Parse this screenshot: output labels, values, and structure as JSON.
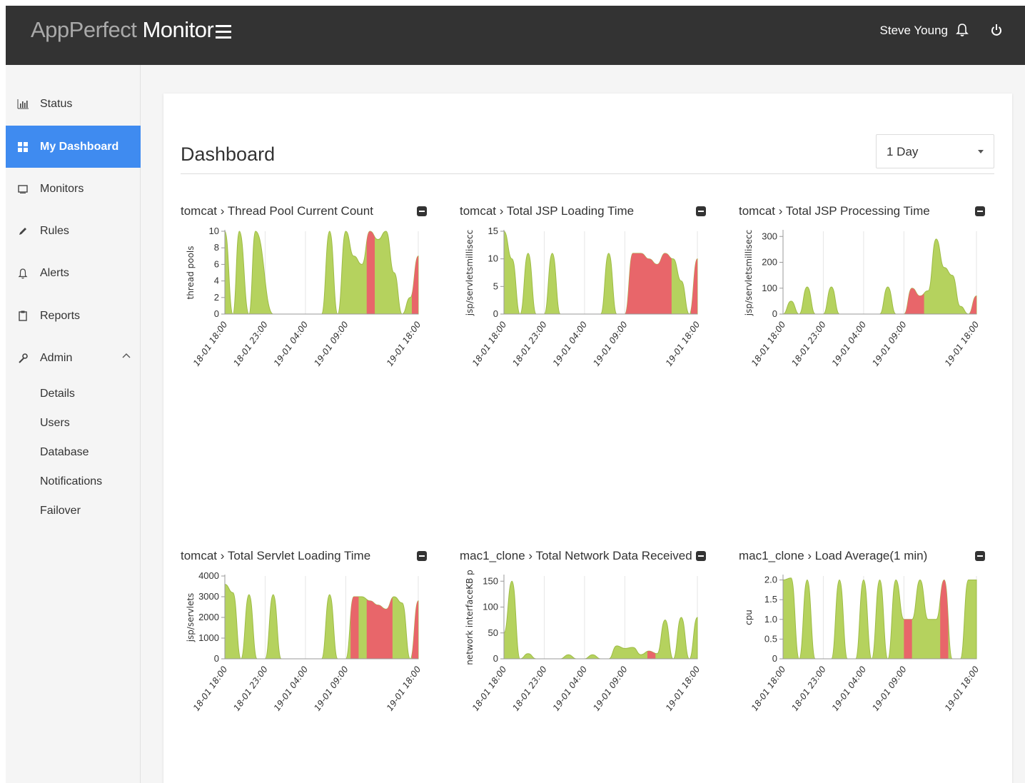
{
  "app": {
    "brand_light": "AppPerfect",
    "brand_strong": " Monitor",
    "user": "Steve Young"
  },
  "sidebar": {
    "items": [
      {
        "label": "Status",
        "icon": "bar-chart-icon"
      },
      {
        "label": "My Dashboard",
        "icon": "grid-icon",
        "active": true
      },
      {
        "label": "Monitors",
        "icon": "monitor-icon"
      },
      {
        "label": "Rules",
        "icon": "pencil-icon"
      },
      {
        "label": "Alerts",
        "icon": "bell-icon"
      },
      {
        "label": "Reports",
        "icon": "clipboard-icon"
      },
      {
        "label": "Admin",
        "icon": "wrench-icon",
        "expanded": true
      }
    ],
    "admin_sub": [
      "Details",
      "Users",
      "Database",
      "Notifications",
      "Failover"
    ]
  },
  "dashboard": {
    "title": "Dashboard",
    "range": "1 Day"
  },
  "colors": {
    "green": "#b5d25e",
    "green_stroke": "#9dbb45",
    "red": "#e8666a",
    "grid": "#e6e6e6"
  },
  "chart_data": [
    {
      "type": "area",
      "title": "tomcat › Thread Pool Current Count",
      "ylabel": "thread pools",
      "yticks": [
        0,
        2,
        4,
        6,
        8,
        10
      ],
      "ylim": [
        0,
        10
      ],
      "xticks": [
        "18-01 18:00",
        "18-01 23:00",
        "19-01 04:00",
        "19-01 09:00",
        "19-01 18:00"
      ],
      "xtick_pos": [
        0,
        5,
        10,
        15,
        24
      ],
      "x": [
        0,
        1,
        1.8,
        3,
        3.8,
        6,
        7,
        8,
        12,
        13,
        14,
        15,
        16,
        17,
        18,
        19,
        20,
        21,
        22,
        23,
        24
      ],
      "y": [
        10,
        0,
        10,
        0,
        10,
        0,
        0,
        0,
        0,
        10,
        0,
        10,
        7,
        6,
        10,
        9,
        10,
        5,
        0,
        2,
        7
      ],
      "red": [
        [
          17.6,
          18.6
        ],
        [
          23.2,
          24
        ]
      ]
    },
    {
      "type": "area",
      "title": "tomcat › Total JSP Loading Time",
      "ylabel": "jsp/servletsmillisecc",
      "yticks": [
        0,
        5,
        10,
        15
      ],
      "ylim": [
        0,
        15
      ],
      "xticks": [
        "18-01 18:00",
        "18-01 23:00",
        "19-01 04:00",
        "19-01 09:00",
        "19-01 18:00"
      ],
      "xtick_pos": [
        0,
        5,
        10,
        15,
        24
      ],
      "x": [
        0,
        1,
        2,
        3,
        4,
        5,
        6,
        7,
        8,
        12,
        13,
        14,
        15,
        16,
        17,
        18,
        19,
        20,
        21,
        22,
        23,
        24
      ],
      "y": [
        15,
        10,
        0,
        11,
        0,
        0,
        11,
        0,
        0,
        0,
        11,
        0,
        0,
        11,
        11,
        10,
        9,
        11,
        10,
        6,
        0,
        10
      ],
      "red": [
        [
          15,
          20.8
        ],
        [
          23.2,
          24
        ]
      ]
    },
    {
      "type": "area",
      "title": "tomcat › Total JSP Processing Time",
      "ylabel": "jsp/servletsmillisecc",
      "yticks": [
        0,
        100,
        200,
        300
      ],
      "ylim": [
        0,
        320
      ],
      "xticks": [
        "18-01 18:00",
        "18-01 23:00",
        "19-01 04:00",
        "19-01 09:00",
        "19-01 18:00"
      ],
      "xtick_pos": [
        0,
        5,
        10,
        15,
        24
      ],
      "x": [
        0,
        1,
        2,
        3,
        4,
        5,
        6,
        7,
        8,
        12,
        13,
        14,
        15,
        16,
        17,
        18,
        19,
        20,
        21,
        22,
        23,
        24
      ],
      "y": [
        0,
        50,
        0,
        105,
        0,
        0,
        105,
        0,
        0,
        0,
        105,
        0,
        0,
        100,
        70,
        90,
        290,
        180,
        150,
        30,
        0,
        70
      ],
      "red": [
        [
          14.5,
          17.5
        ],
        [
          23.2,
          24
        ]
      ]
    },
    {
      "type": "area",
      "title": "tomcat › Total Servlet Loading Time",
      "ylabel": "jsp/servlets",
      "yticks": [
        0,
        1000,
        2000,
        3000,
        4000
      ],
      "ylim": [
        0,
        4000
      ],
      "xticks": [
        "18-01 18:00",
        "18-01 23:00",
        "19-01 04:00",
        "19-01 09:00",
        "19-01 18:00"
      ],
      "xtick_pos": [
        0,
        5,
        10,
        15,
        24
      ],
      "x": [
        0,
        1,
        2,
        3,
        4,
        5,
        6,
        7,
        8,
        12,
        13,
        14,
        15,
        16,
        17,
        18,
        19,
        20,
        21,
        22,
        23,
        24
      ],
      "y": [
        3600,
        3200,
        0,
        3100,
        0,
        0,
        3100,
        0,
        0,
        0,
        3100,
        0,
        0,
        3000,
        3000,
        2800,
        2600,
        2400,
        3000,
        2700,
        0,
        2800
      ],
      "red": [
        [
          15.6,
          16.6
        ],
        [
          17.6,
          20.8
        ],
        [
          23.2,
          24
        ]
      ]
    },
    {
      "type": "area",
      "title": "mac1_clone › Total Network Data Received",
      "ylabel": "network interfaceKB p",
      "yticks": [
        0,
        50,
        100,
        150
      ],
      "ylim": [
        0,
        160
      ],
      "xticks": [
        "18-01 18:00",
        "18-01 23:00",
        "19-01 04:00",
        "19-01 09:00",
        "19-01 18:00"
      ],
      "xtick_pos": [
        0,
        5,
        10,
        15,
        24
      ],
      "x": [
        0,
        1,
        2,
        3,
        4,
        5,
        6,
        7,
        8,
        9,
        10,
        11,
        12,
        13,
        14,
        15,
        16,
        17,
        18,
        19,
        20,
        21,
        22,
        23,
        24
      ],
      "y": [
        50,
        150,
        0,
        10,
        0,
        0,
        0,
        0,
        8,
        0,
        0,
        8,
        0,
        0,
        25,
        20,
        22,
        8,
        15,
        10,
        75,
        0,
        80,
        0,
        80
      ],
      "red": [
        [
          17.8,
          18.8
        ]
      ]
    },
    {
      "type": "area",
      "title": "mac1_clone › Load Average(1 min)",
      "ylabel": "cpu",
      "yticks": [
        0,
        0.5,
        1.0,
        1.5,
        2.0
      ],
      "ylim": [
        0,
        2.1
      ],
      "xticks": [
        "18-01 18:00",
        "18-01 23:00",
        "19-01 04:00",
        "19-01 09:00",
        "19-01 18:00"
      ],
      "xtick_pos": [
        0,
        5,
        10,
        15,
        24
      ],
      "x": [
        0,
        1,
        2,
        3,
        4,
        5,
        6,
        7,
        8,
        9,
        10,
        11,
        12,
        13,
        14,
        15,
        16,
        17,
        18,
        19,
        20,
        21,
        22,
        23,
        24
      ],
      "y": [
        2.0,
        2.05,
        0,
        2.0,
        0,
        0,
        0,
        2.0,
        0,
        0,
        2.0,
        0,
        2.0,
        0,
        2.0,
        1.0,
        1.0,
        2.0,
        1.0,
        1.0,
        2.0,
        0,
        0,
        2.0,
        2.0
      ],
      "red": [
        [
          15,
          16
        ],
        [
          19.5,
          20.5
        ]
      ]
    }
  ]
}
